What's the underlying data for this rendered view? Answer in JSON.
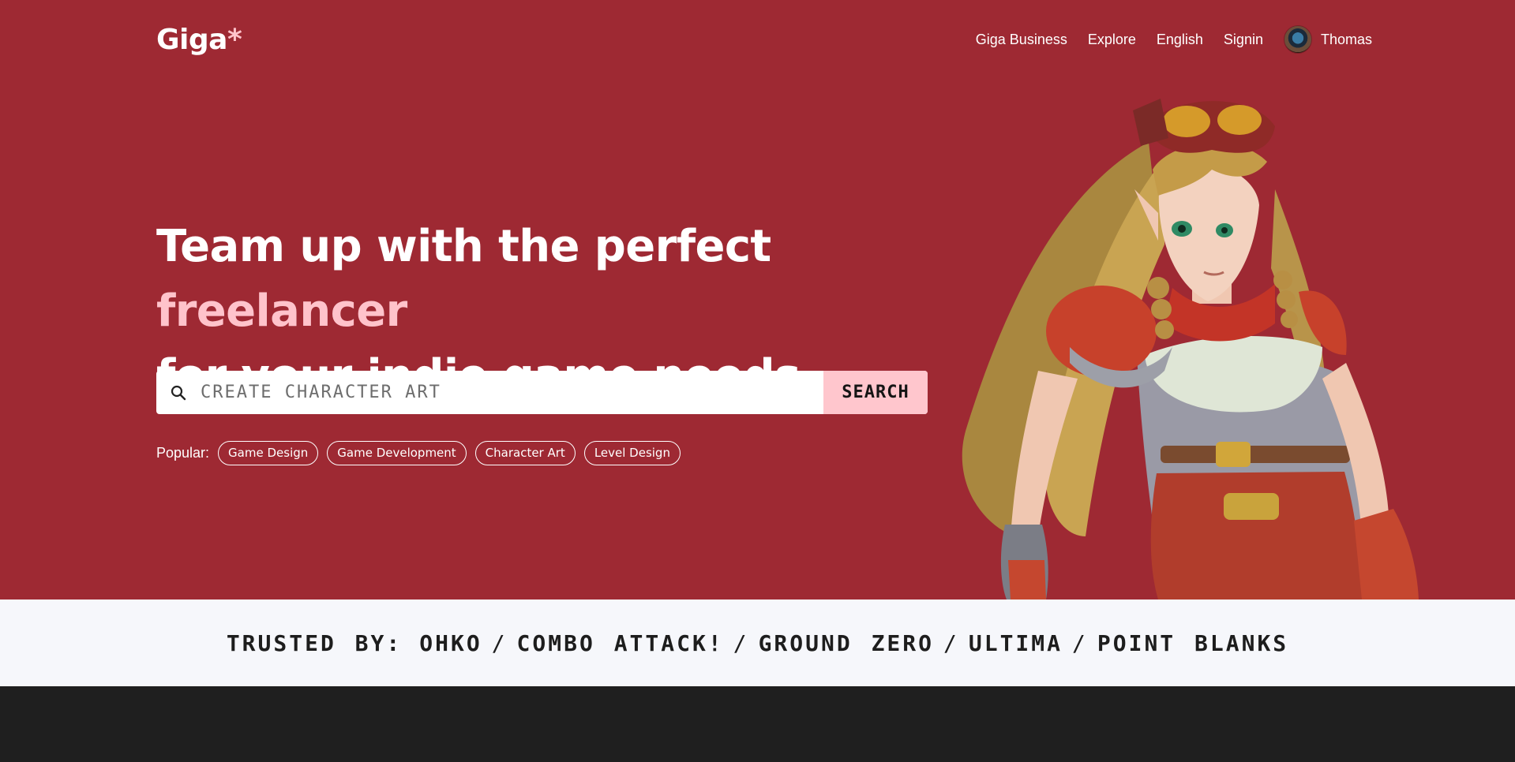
{
  "brand": {
    "name": "Giga",
    "mark": "*"
  },
  "nav": {
    "items": [
      "Giga Business",
      "Explore",
      "English",
      "Signin"
    ],
    "user_name": "Thomas"
  },
  "hero": {
    "headline_pre": "Team up with the perfect",
    "headline_accent": "freelancer",
    "headline_post": "for your indie game needs."
  },
  "search": {
    "placeholder": "CREATE CHARACTER ART",
    "button_label": "SEARCH",
    "icon": "search-icon"
  },
  "popular": {
    "label": "Popular:",
    "tags": [
      "Game Design",
      "Game Development",
      "Character Art",
      "Level Design"
    ]
  },
  "trusted": {
    "label": "TRUSTED BY:",
    "separator": "/",
    "companies": [
      "OHKO",
      "COMBO ATTACK!",
      "GROUND ZERO",
      "ULTIMA",
      "POINT BLANKS"
    ]
  },
  "colors": {
    "hero_bg": "#9e2933",
    "accent_pink": "#ffc3cb",
    "search_button_bg": "#ffc6cd",
    "trusted_bg": "#f6f7fb",
    "footer_bg": "#1f1f1f"
  }
}
